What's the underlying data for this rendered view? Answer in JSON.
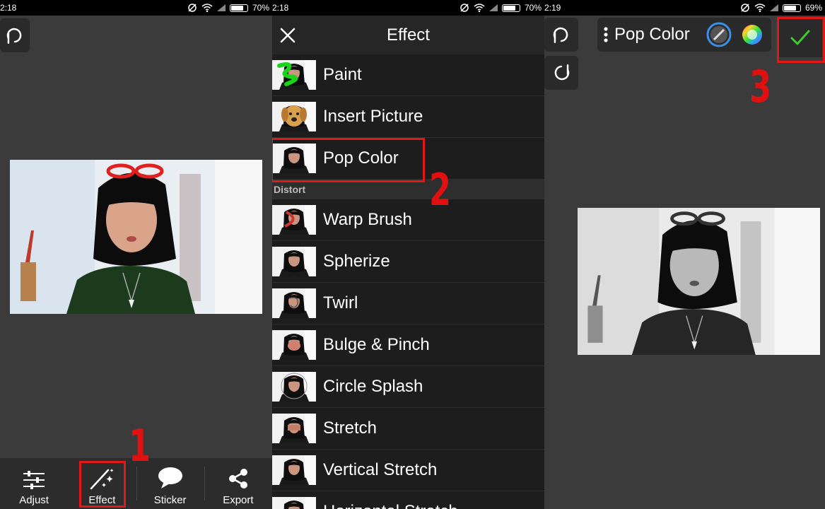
{
  "panel1": {
    "status": {
      "time": "2:18",
      "battery": "70%"
    },
    "toolbar": [
      {
        "label": "Adjust",
        "icon": "sliders-icon"
      },
      {
        "label": "Effect",
        "icon": "magic-wand-icon"
      },
      {
        "label": "Sticker",
        "icon": "speech-bubble-icon"
      },
      {
        "label": "Export",
        "icon": "share-icon"
      }
    ],
    "annotation": "1"
  },
  "panel2": {
    "status": {
      "time": "2:18",
      "battery": "70%"
    },
    "title": "Effect",
    "items_top": [
      "Paint",
      "Insert Picture",
      "Pop Color"
    ],
    "section": "Distort",
    "items_distort": [
      "Warp Brush",
      "Spherize",
      "Twirl",
      "Bulge & Pinch",
      "Circle Splash",
      "Stretch",
      "Vertical Stretch",
      "Horizontal Stretch"
    ],
    "annotation": "2"
  },
  "panel3": {
    "status": {
      "time": "2:19",
      "battery": "69%"
    },
    "tool_name": "Pop Color",
    "annotation": "3"
  },
  "colors": {
    "annotation_red": "#e01010",
    "check_green": "#3dcc2e",
    "accent_blue": "#3d8ee8"
  }
}
